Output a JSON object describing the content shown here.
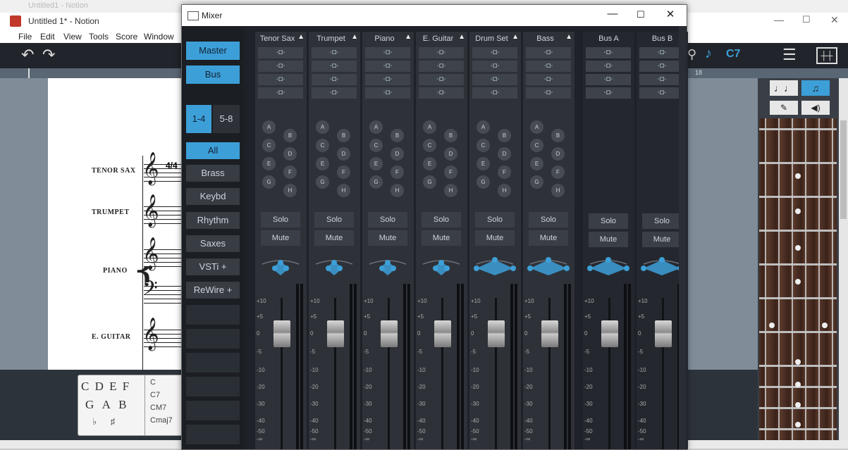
{
  "notion": {
    "ghost_title": "Untitled1 - Notion",
    "title": "Untitled 1* - Notion",
    "menu": [
      "File",
      "Edit",
      "View",
      "Tools",
      "Score",
      "Window"
    ],
    "chord_symbol": "C7",
    "instruments": [
      "TENOR SAX",
      "TRUMPET",
      "PIANO",
      "E. GUITAR"
    ],
    "time_sig": "4/4",
    "chord_pad": {
      "notes_row1": "C D E F",
      "notes_row2": "G A B",
      "accidentals": "♭ ♯",
      "chords": [
        "C",
        "C7",
        "CM7",
        "Cmaj7"
      ]
    },
    "ruler_marker": "18"
  },
  "mixer": {
    "title": "Mixer",
    "left_panel": {
      "master": "Master",
      "bus": "Bus",
      "range1": "1-4",
      "range2": "5-8",
      "all": "All",
      "brass": "Brass",
      "keybd": "Keybd",
      "rhythm": "Rhythm",
      "saxes": "Saxes",
      "vsti": "VSTi",
      "rewire": "ReWire",
      "plus": "+"
    },
    "channels": [
      {
        "name": "Tenor Sax"
      },
      {
        "name": "Trumpet"
      },
      {
        "name": "Piano"
      },
      {
        "name": "E. Guitar"
      },
      {
        "name": "Drum Set"
      },
      {
        "name": "Bass"
      },
      {
        "name": "Bus A"
      },
      {
        "name": "Bus B"
      }
    ],
    "insert_glyph": "-◘-",
    "sends": [
      "A",
      "B",
      "C",
      "D",
      "E",
      "F",
      "G",
      "H"
    ],
    "solo": "Solo",
    "mute": "Mute",
    "scale": [
      "+10",
      "+5",
      "0",
      "-5",
      "-10",
      "-20",
      "-30",
      "-40",
      "-50",
      "-∞"
    ],
    "accent": "#3d9fd8"
  }
}
